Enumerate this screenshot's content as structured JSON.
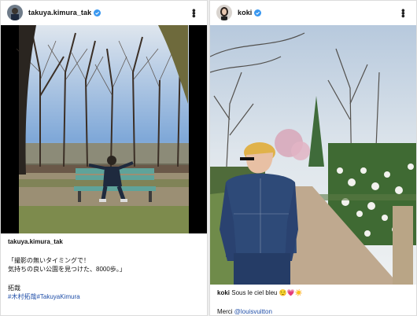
{
  "left_post": {
    "username": "takuya.kimura_tak",
    "caption_username": "takuya.kimura_tak",
    "caption_lines": [
      "「撮影の無いタイミングで！",
      "気持ちの良い公園を見つけた、8000歩。」"
    ],
    "signoff": "拓哉",
    "hashtags": "#木村拓哉#TakuyaKimura",
    "more_icon": "more-vertical-icon"
  },
  "right_post": {
    "username": "koki",
    "caption_username": "koki",
    "caption_text": " Sous le ciel bleu 😌💗☀️",
    "caption_line2_prefix": "Merci ",
    "mention": "@louisvuitton",
    "more_icon": "more-vertical-icon"
  },
  "colors": {
    "verified": "#3897f0",
    "link": "#1f4ea8",
    "bench": "#5fa39a"
  }
}
